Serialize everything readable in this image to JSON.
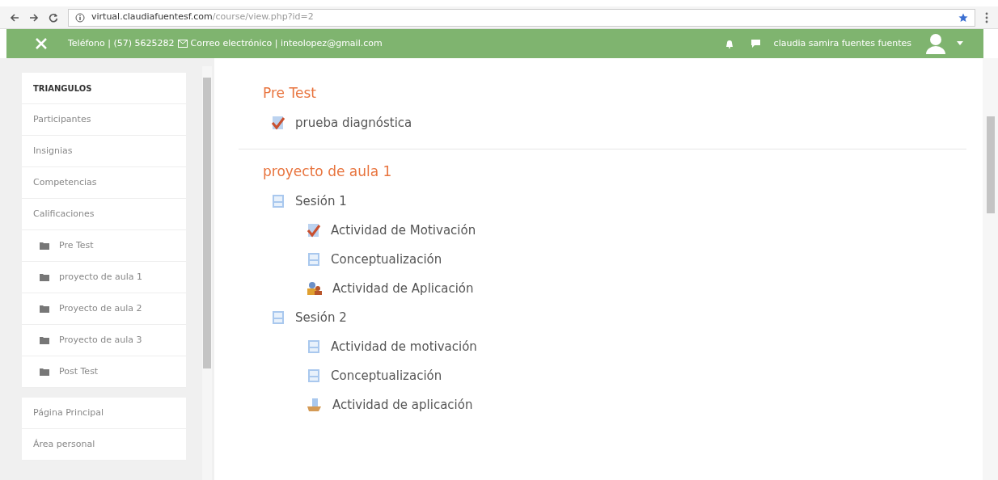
{
  "browser": {
    "url_domain": "virtual.claudiafuentesf.com",
    "url_path": "/course/view.php?id=2"
  },
  "header": {
    "phone": "Teléfono | (57) 5625282",
    "email": "Correo electrónico | inteolopez@gmail.com",
    "user": "claudia samira fuentes fuentes"
  },
  "sidebar": {
    "title": "TRIANGULOS",
    "items": [
      {
        "label": "Participantes",
        "kind": "link"
      },
      {
        "label": "Insignias",
        "kind": "link"
      },
      {
        "label": "Competencias",
        "kind": "link"
      },
      {
        "label": "Calificaciones",
        "kind": "link"
      },
      {
        "label": "Pre Test",
        "kind": "folder"
      },
      {
        "label": "proyecto de aula 1",
        "kind": "folder"
      },
      {
        "label": "Proyecto de aula 2",
        "kind": "folder"
      },
      {
        "label": "Proyecto de aula 3",
        "kind": "folder"
      },
      {
        "label": "Post Test",
        "kind": "folder"
      }
    ],
    "bottom_items": [
      {
        "label": "Página Principal"
      },
      {
        "label": "Área personal"
      }
    ]
  },
  "sections": [
    {
      "title": "Pre Test",
      "items": [
        {
          "label": "prueba diagnóstica",
          "kind": "quiz"
        }
      ]
    },
    {
      "title": "proyecto de aula 1",
      "items": [
        {
          "label": "Sesión 1",
          "kind": "page",
          "children": [
            {
              "label": "Actividad de Motivación",
              "kind": "quiz"
            },
            {
              "label": "Conceptualización",
              "kind": "page"
            },
            {
              "label": "Actividad de Aplicación",
              "kind": "workshop"
            }
          ]
        },
        {
          "label": "Sesión 2",
          "kind": "page",
          "children": [
            {
              "label": "Actividad de motivación",
              "kind": "page"
            },
            {
              "label": "Conceptualización",
              "kind": "page"
            },
            {
              "label": "Actividad de aplicación",
              "kind": "assignment"
            }
          ]
        }
      ]
    }
  ]
}
